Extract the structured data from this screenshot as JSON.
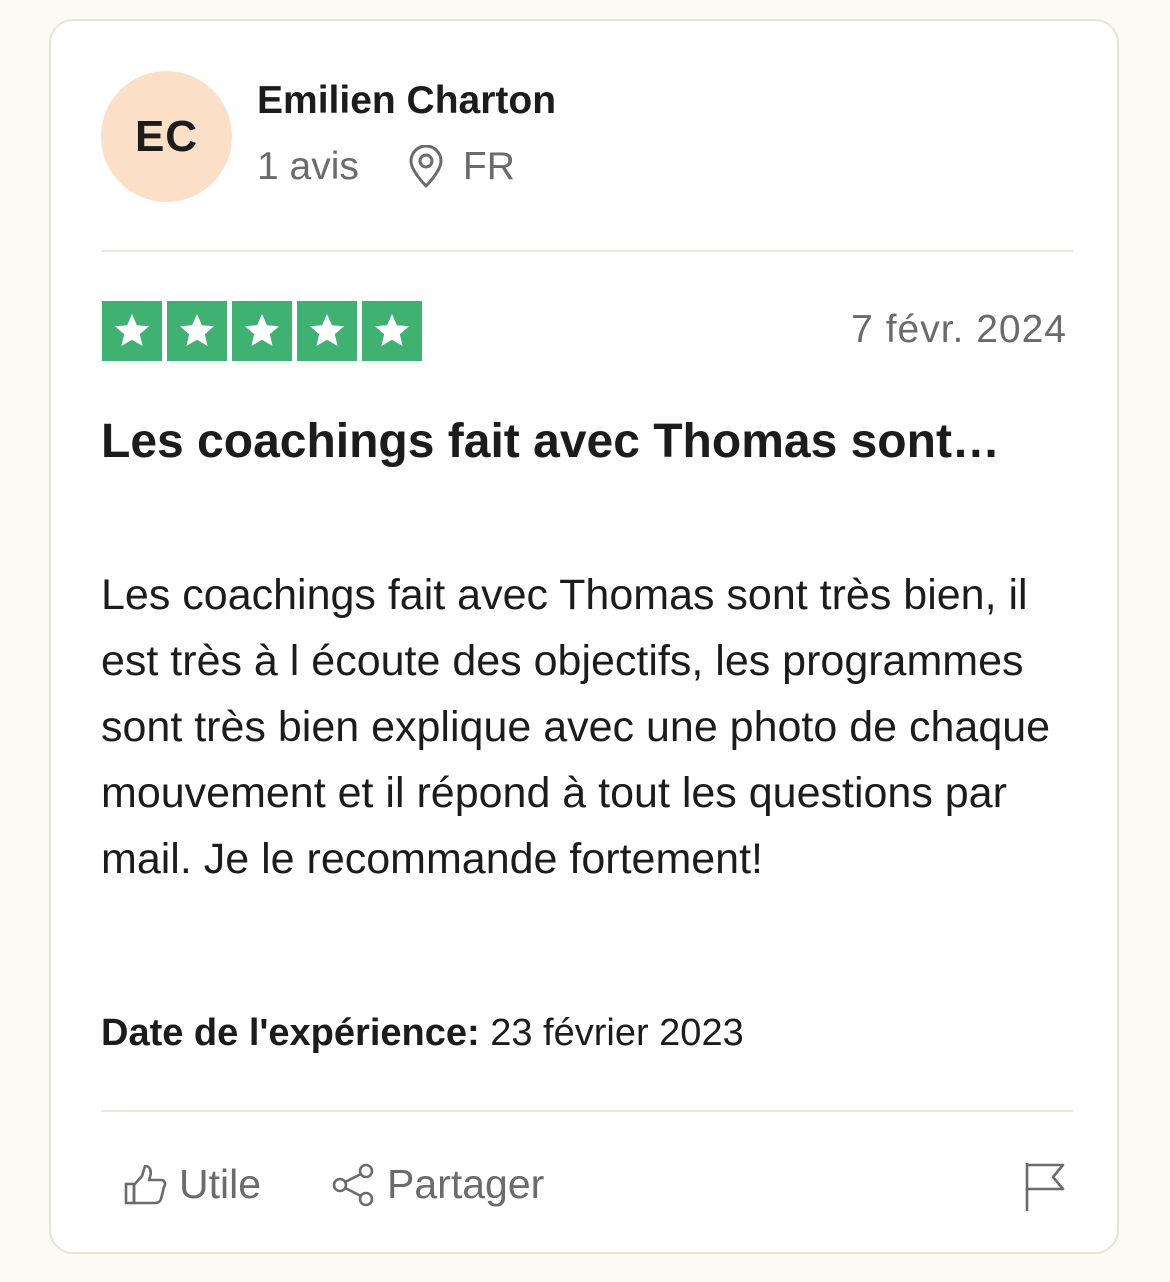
{
  "reviewer": {
    "initials": "EC",
    "name": "Emilien Charton",
    "review_count": "1 avis",
    "country": "FR",
    "avatar_color": "#fbe0c7"
  },
  "review": {
    "rating": 5,
    "max_rating": 5,
    "star_color": "#3fb272",
    "date": "7 févr. 2024",
    "title": "Les coachings fait avec Thomas sont…",
    "body": "Les coachings fait avec Thomas sont très bien, il est très à l écoute des objectifs, les programmes sont très bien explique avec une photo de chaque mouvement et il répond à tout les questions par mail. Je le recommande fortement!",
    "experience_label": "Date de l'expérience:",
    "experience_date": "23 février 2023"
  },
  "actions": {
    "useful_label": "Utile",
    "share_label": "Partager",
    "useful_icon": "thumbs-up-icon",
    "share_icon": "share-icon",
    "flag_icon": "flag-icon"
  }
}
